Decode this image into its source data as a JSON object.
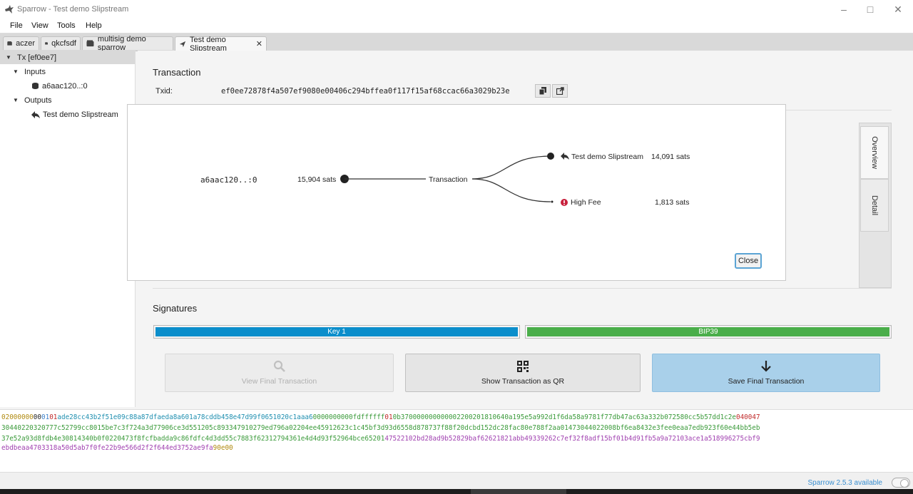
{
  "window": {
    "title": "Sparrow - Test demo Slipstream"
  },
  "menu": [
    "File",
    "View",
    "Tools",
    "Help"
  ],
  "tabs": [
    {
      "label": "aczer"
    },
    {
      "label": "qkcfsdf"
    },
    {
      "label": "multisig demo sparrow"
    },
    {
      "label": "Test demo Slipstream"
    }
  ],
  "tree": {
    "root": "Tx [ef0ee7]",
    "inputs_label": "Inputs",
    "input_item": "a6aac120..:0",
    "outputs_label": "Outputs",
    "output_item": "Test demo Slipstream"
  },
  "transaction": {
    "title": "Transaction",
    "txid_label": "Txid:",
    "txid": "ef0ee72878f4a507ef9080e00406c294bffea0f117f15af68ccac66a3029b23e"
  },
  "diagram": {
    "input_label": "a6aac120..:0",
    "input_amount": "15,904 sats",
    "center_label": "Transaction",
    "output1_label": "Test demo Slipstream",
    "output1_amount": "14,091 sats",
    "output2_label": "High Fee",
    "output2_amount": "1,813 sats",
    "close_label": "Close"
  },
  "side_tabs": {
    "overview": "Overview",
    "detail": "Detail"
  },
  "signatures": {
    "title": "Signatures",
    "key1": "Key 1",
    "key2": "BIP39",
    "key1_color": "#0b8ecb",
    "key2_color": "#4aae4a"
  },
  "actions": {
    "view_final": "View Final Transaction",
    "show_qr": "Show Transaction as QR",
    "save_final": "Save Final Transaction"
  },
  "hex": {
    "line1": [
      {
        "t": "02000000",
        "c": "#b08a10"
      },
      {
        "t": "00",
        "c": "#222222"
      },
      {
        "t": "01",
        "c": "#3a7fc9"
      },
      {
        "t": "01",
        "c": "#c02a2a"
      },
      {
        "t": "ade28cc43b2f51e09c88a87dfaeda8a601a78cddb458e47d99f0651020c1aaa6",
        "c": "#1f8fb0"
      },
      {
        "t": "0000000000",
        "c": "#3a9a3a"
      },
      {
        "t": "fdffffff",
        "c": "#3a9a3a"
      },
      {
        "t": "01",
        "c": "#c02a2a"
      },
      {
        "t": "0b37000000000000",
        "c": "#3a9a3a"
      },
      {
        "t": "22002018106",
        "c": "#3a9a3a"
      },
      {
        "t": "40a195e5a992d1f6da58a9781f77db47ac63a332b072580cc5b57dd1c2e",
        "c": "#3a9a3a"
      },
      {
        "t": "040047",
        "c": "#c02a2a"
      }
    ],
    "line2": "30440220320777c52799cc8015be7c3f724a3d77906ce3d551205c893347910279ed796a02204ee45912623c1c45bf3d93d6558d878737f88f20dcbd152dc28fac80e788f2aa01473044022008bf6ea8432e3fee0eaa7edb923f60e44bb5eb",
    "line3a": "37e52a93d8fdb4e30814340b0f0220473f8fcfbadda9c86fdfc4d3dd55c7883f62312794361e4d4d93f52964bce65201",
    "line3b": "47522102bd28ad9b52829baf62621821abb49339262c7ef32f8adf15bf01b4d91fb5a9a72103ace1a518996275cbf9",
    "line4": "ebdbeaa4703318a50d5ab7f0fe22b9e566d2f2f644ed3752ae9fa",
    "line4_end": "90e00",
    "green": "#3a9a3a",
    "purple": "#a040b0",
    "gold": "#b08a10"
  },
  "status": {
    "update_text": "Sparrow 2.5.3 available"
  }
}
